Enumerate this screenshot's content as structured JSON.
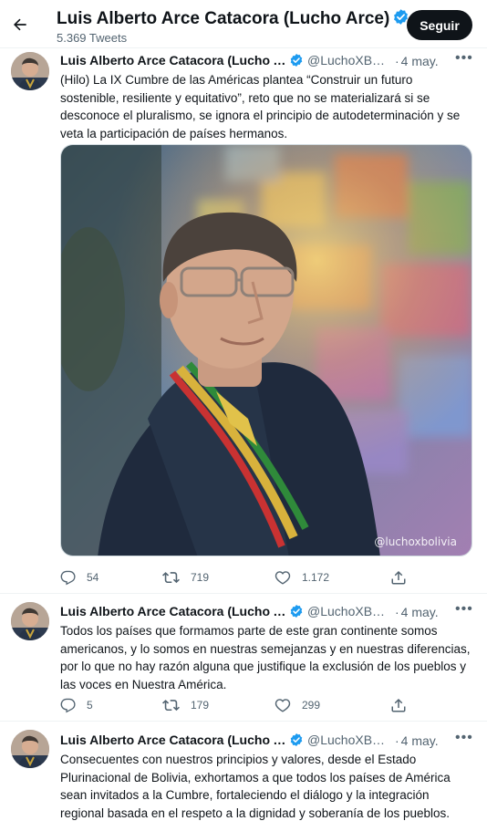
{
  "header": {
    "name": "Luis Alberto Arce Catacora (Lucho Arce)",
    "tweets_count": "5.369 Tweets",
    "follow_label": "Seguir"
  },
  "tweets": [
    {
      "author": "Luis Alberto Arce Catacora (Lucho Arce)",
      "handle": "@LuchoXBolivia",
      "separator": "·",
      "date": "4 may.",
      "text": "(Hilo) La IX Cumbre de las Américas plantea “Construir un futuro sostenible, resiliente y equitativo”, reto que no se materializará si se desconoce el pluralismo, se ignora el principio de autodeterminación y se veta la participación de países hermanos.",
      "media_watermark": "@luchoxbolivia",
      "replies": "54",
      "retweets": "719",
      "likes": "1.172"
    },
    {
      "author": "Luis Alberto Arce Catacora (Lucho Arce)",
      "handle": "@LuchoXBolivia",
      "separator": "·",
      "date": "4 may.",
      "text": "Todos los países que formamos parte de este gran continente somos americanos, y lo somos en nuestras semejanzas y en nuestras diferencias, por lo que no hay razón alguna que justifique la exclusión de los pueblos y las voces en Nuestra América.",
      "replies": "5",
      "retweets": "179",
      "likes": "299"
    },
    {
      "author": "Luis Alberto Arce Catacora (Lucho Arce)",
      "handle": "@LuchoXBolivia",
      "separator": "·",
      "date": "4 may.",
      "text": "Consecuentes con nuestros principios y valores, desde el Estado Plurinacional de Bolivia, exhortamos a que todos los países de América sean invitados a la Cumbre, fortaleciendo el diálogo y la integración regional basada en el respeto a la dignidad y soberanía de los pueblos."
    }
  ],
  "colors": {
    "accent": "#1d9bf0",
    "follow_bg": "#0f1419",
    "secondary_text": "#536471",
    "border": "#eff3f4"
  },
  "icons": {
    "back": "arrow-left-icon",
    "verified": "verified-badge-icon",
    "more": "more-dots-icon",
    "reply": "reply-icon",
    "retweet": "retweet-icon",
    "like": "heart-icon",
    "share": "share-icon"
  }
}
